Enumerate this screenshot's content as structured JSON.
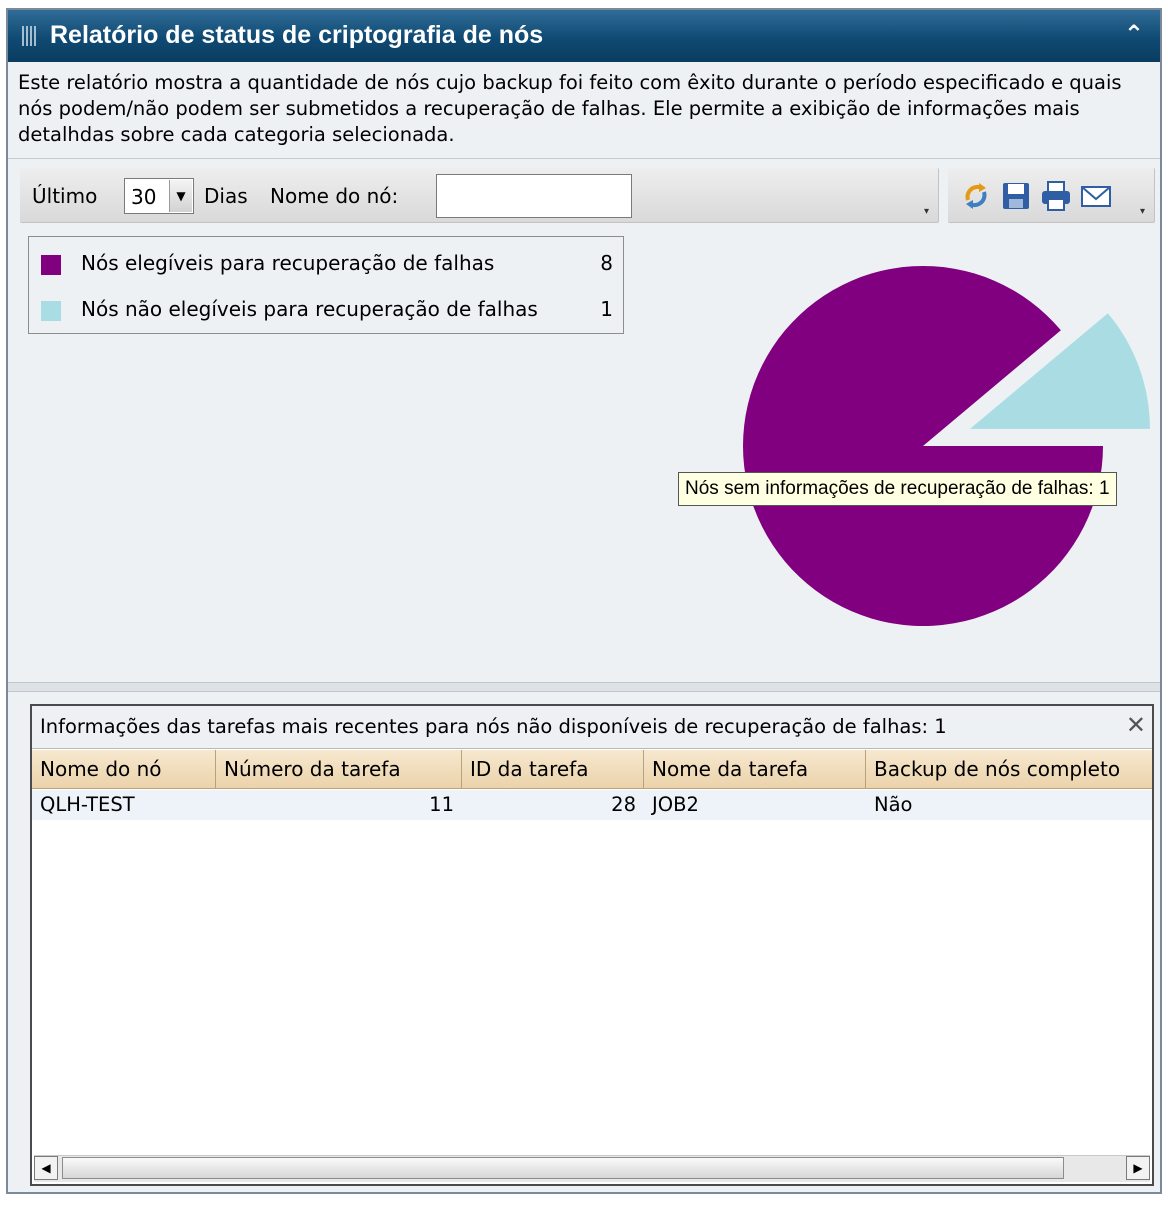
{
  "window": {
    "title": "Relatório de status de criptografia de nós",
    "collapse_icon": "double-chevron-up-icon"
  },
  "description": "Este relatório mostra a quantidade de nós cujo backup foi feito com êxito durante o período especificado e quais nós podem/não podem ser submetidos a recuperação de falhas. Ele permite a exibição de informações mais detalhdas sobre cada categoria selecionada.",
  "filters": {
    "last_label": "Último",
    "days_value": "30",
    "days_label": "Dias",
    "node_name_label": "Nome do nó:",
    "node_name_value": ""
  },
  "toolbar_icons": [
    "refresh-icon",
    "save-icon",
    "print-icon",
    "email-icon"
  ],
  "legend": [
    {
      "label": "Nós elegíveis para recuperação de falhas",
      "value": "8",
      "color": "#800080"
    },
    {
      "label": "Nós não elegíveis para recuperação de falhas",
      "value": "1",
      "color": "#a9dde3"
    }
  ],
  "tooltip": "Nós sem informações de recuperação de falhas: 1",
  "chart_data": {
    "type": "pie",
    "slices": [
      {
        "name": "Nós elegíveis para recuperação de falhas",
        "value": 8,
        "color": "#800080"
      },
      {
        "name": "Nós não elegíveis para recuperação de falhas",
        "value": 1,
        "color": "#a9dde3",
        "exploded": true
      }
    ]
  },
  "grid": {
    "title": "Informações das tarefas mais recentes para nós não disponíveis de recuperação de falhas: 1",
    "columns": [
      "Nome do nó",
      "Número da tarefa",
      "ID da tarefa",
      "Nome da tarefa",
      "Backup de nós completo"
    ],
    "rows": [
      [
        "QLH-TEST",
        "11",
        "28",
        "JOB2",
        "Não"
      ]
    ]
  }
}
